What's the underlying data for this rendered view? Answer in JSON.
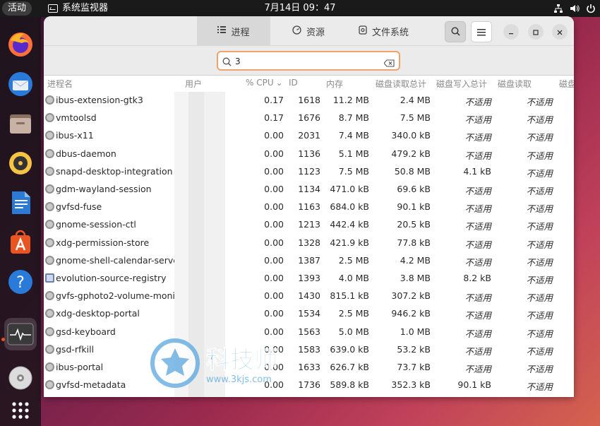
{
  "topbar": {
    "activities": "活动",
    "app_name": "系统监视器",
    "clock": "7月14日  09：47"
  },
  "window": {
    "tabs": [
      {
        "label": "进程",
        "icon": "list-icon"
      },
      {
        "label": "资源",
        "icon": "resources-icon"
      },
      {
        "label": "文件系统",
        "icon": "disk-icon"
      }
    ],
    "search_value": "3",
    "columns": [
      "进程名",
      "用户",
      "% CPU",
      "ID",
      "内存",
      "磁盘读取总计",
      "磁盘写入总计",
      "磁盘读取",
      "磁盘"
    ],
    "rows": [
      {
        "name": "ibus-extension-gtk3",
        "cpu": "0.17",
        "id": "1618",
        "mem": "11.2 MB",
        "read_total": "2.4 MB",
        "write_total": "不适用",
        "read": "不适用"
      },
      {
        "name": "vmtoolsd",
        "cpu": "0.17",
        "id": "1676",
        "mem": "8.7 MB",
        "read_total": "7.5 MB",
        "write_total": "不适用",
        "read": "不适用"
      },
      {
        "name": "ibus-x11",
        "cpu": "0.00",
        "id": "2031",
        "mem": "7.4 MB",
        "read_total": "340.0 kB",
        "write_total": "不适用",
        "read": "不适用"
      },
      {
        "name": "dbus-daemon",
        "cpu": "0.00",
        "id": "1136",
        "mem": "5.1 MB",
        "read_total": "479.2 kB",
        "write_total": "不适用",
        "read": "不适用"
      },
      {
        "name": "snapd-desktop-integration",
        "cpu": "0.00",
        "id": "1123",
        "mem": "7.5 MB",
        "read_total": "50.8 MB",
        "write_total": "4.1 kB",
        "read": "不适用"
      },
      {
        "name": "gdm-wayland-session",
        "cpu": "0.00",
        "id": "1134",
        "mem": "471.0 kB",
        "read_total": "69.6 kB",
        "write_total": "不适用",
        "read": "不适用"
      },
      {
        "name": "gvfsd-fuse",
        "cpu": "0.00",
        "id": "1163",
        "mem": "684.0 kB",
        "read_total": "90.1 kB",
        "write_total": "不适用",
        "read": "不适用"
      },
      {
        "name": "gnome-session-ctl",
        "cpu": "0.00",
        "id": "1213",
        "mem": "442.4 kB",
        "read_total": "20.5 kB",
        "write_total": "不适用",
        "read": "不适用"
      },
      {
        "name": "xdg-permission-store",
        "cpu": "0.00",
        "id": "1328",
        "mem": "421.9 kB",
        "read_total": "77.8 kB",
        "write_total": "不适用",
        "read": "不适用"
      },
      {
        "name": "gnome-shell-calendar-server",
        "cpu": "0.00",
        "id": "1387",
        "mem": "2.5 MB",
        "read_total": "4.2 MB",
        "write_total": "不适用",
        "read": "不适用"
      },
      {
        "name": "evolution-source-registry",
        "cpu": "0.00",
        "id": "1393",
        "mem": "4.0 MB",
        "read_total": "3.8 MB",
        "write_total": "8.2 kB",
        "read": "不适用",
        "icon": "doc"
      },
      {
        "name": "gvfs-gphoto2-volume-monito",
        "cpu": "0.00",
        "id": "1430",
        "mem": "815.1 kB",
        "read_total": "307.2 kB",
        "write_total": "不适用",
        "read": "不适用"
      },
      {
        "name": "xdg-desktop-portal",
        "cpu": "0.00",
        "id": "1534",
        "mem": "2.5 MB",
        "read_total": "946.2 kB",
        "write_total": "不适用",
        "read": "不适用"
      },
      {
        "name": "gsd-keyboard",
        "cpu": "0.00",
        "id": "1563",
        "mem": "5.0 MB",
        "read_total": "1.0 MB",
        "write_total": "不适用",
        "read": "不适用"
      },
      {
        "name": "gsd-rfkill",
        "cpu": "0.00",
        "id": "1583",
        "mem": "639.0 kB",
        "read_total": "53.2 kB",
        "write_total": "不适用",
        "read": "不适用"
      },
      {
        "name": "ibus-portal",
        "cpu": "0.00",
        "id": "1633",
        "mem": "626.7 kB",
        "read_total": "73.7 kB",
        "write_total": "不适用",
        "read": "不适用"
      },
      {
        "name": "gvfsd-metadata",
        "cpu": "0.00",
        "id": "1736",
        "mem": "589.8 kB",
        "read_total": "352.3 kB",
        "write_total": "90.1 kB",
        "read": "不适用"
      }
    ]
  },
  "watermark": {
    "brand": "科技师",
    "url": "www.3kjs.com"
  },
  "colors": {
    "accent": "#e95420",
    "search_border": "#f0a26c"
  }
}
